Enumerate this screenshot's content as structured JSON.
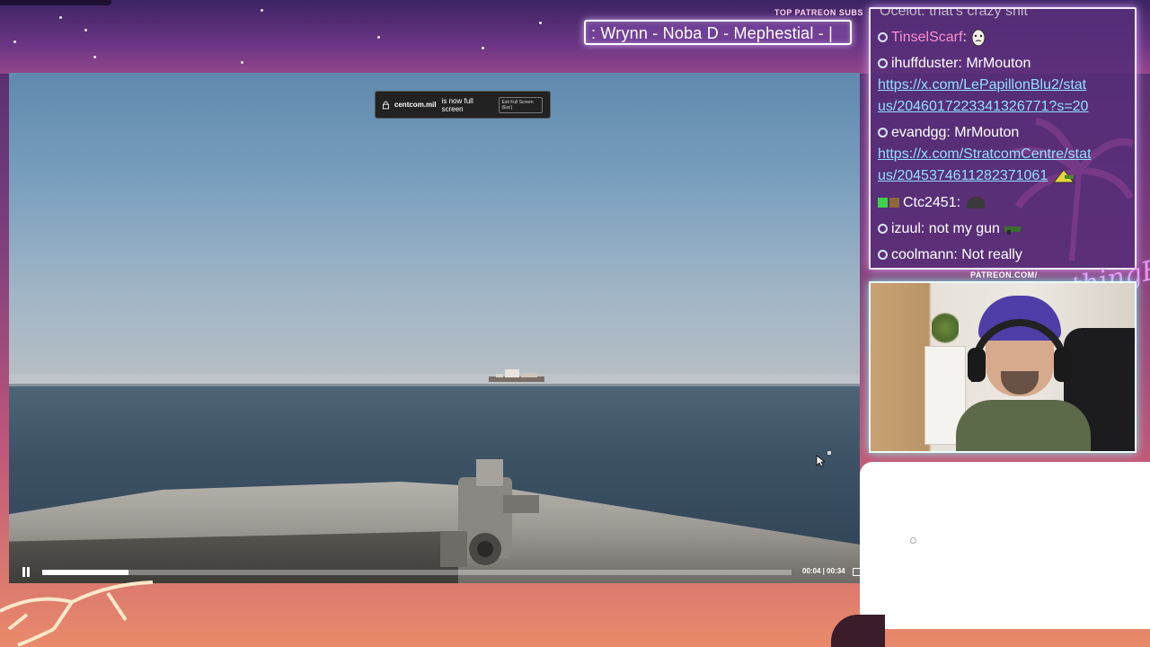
{
  "overlay": {
    "patreon_subs_title": "TOP PATREON SUBS",
    "ticker_text": ": Wrynn -  Noba D - Mephestial - |",
    "patreon_label": "PATREON.COM/",
    "signature": "AnythingElse"
  },
  "video": {
    "fullscreen_notice": {
      "host": "centcom.mil",
      "message": "is now full screen",
      "exit_hint": "Exit Full Screen (Esc)"
    },
    "time_display": "00:04 | 00:34",
    "progress": 0.115
  },
  "chat": {
    "cutoff_line": "Ocelot: that's crazy shit",
    "messages": [
      {
        "user": "TinselScarf",
        "text": "",
        "user_color": "#ff8fd0",
        "emote": "face-emote"
      },
      {
        "user": "ihuffduster",
        "text": "MrMouton"
      },
      {
        "link": "https://x.com/LePapillonBlu2/status/2046017223341326771?s=20",
        "link_line1": "https://x.com/LePapillonBlu2/stat",
        "link_line2": "us/2046017223341326771?s=20"
      },
      {
        "user": "evandgg",
        "text": "MrMouton"
      },
      {
        "link": "https://x.com/StratcomCentre/status/2045374611282371061",
        "link_line1": "https://x.com/StratcomCentre/stat",
        "link_line2": "us/2045374611282371061"
      },
      {
        "user": "Ctc2451",
        "text": "",
        "emote": "helmet-emote"
      },
      {
        "user": "izuul",
        "text": "not my gun"
      },
      {
        "user": "coolmann",
        "text": "Not really"
      }
    ]
  }
}
